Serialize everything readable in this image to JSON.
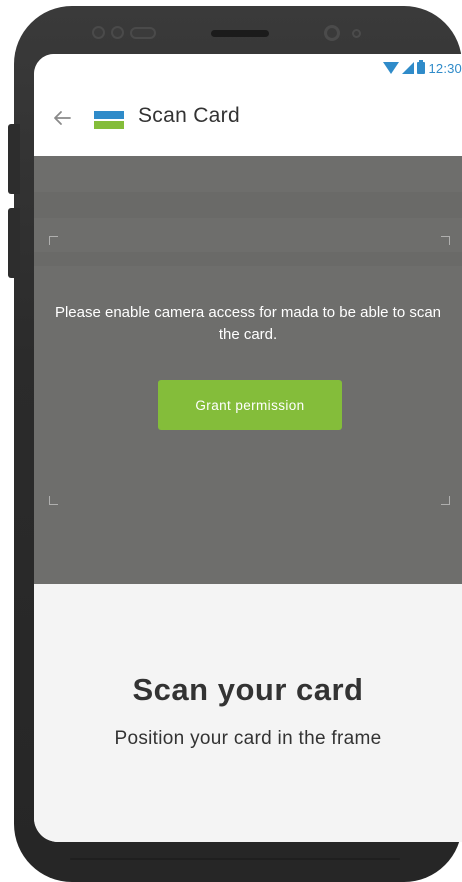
{
  "status_bar": {
    "time": "12:30",
    "wifi_icon": "wifi-icon",
    "signal_icon": "cell-signal-icon",
    "battery_icon": "battery-icon",
    "accent_color": "#2f8bc9"
  },
  "app_bar": {
    "back_icon": "arrow-back-icon",
    "logo_icon": "mada-logo-icon",
    "title": "Scan Card",
    "logo_colors": [
      "#2f8bc9",
      "#84bd3a"
    ]
  },
  "camera": {
    "permission_message": "Please enable camera access for mada to be able to scan the card.",
    "grant_button_label": "Grant permission",
    "button_color": "#84bd3a"
  },
  "instructions": {
    "heading": "Scan your card",
    "subtext": "Position your card in the frame"
  }
}
